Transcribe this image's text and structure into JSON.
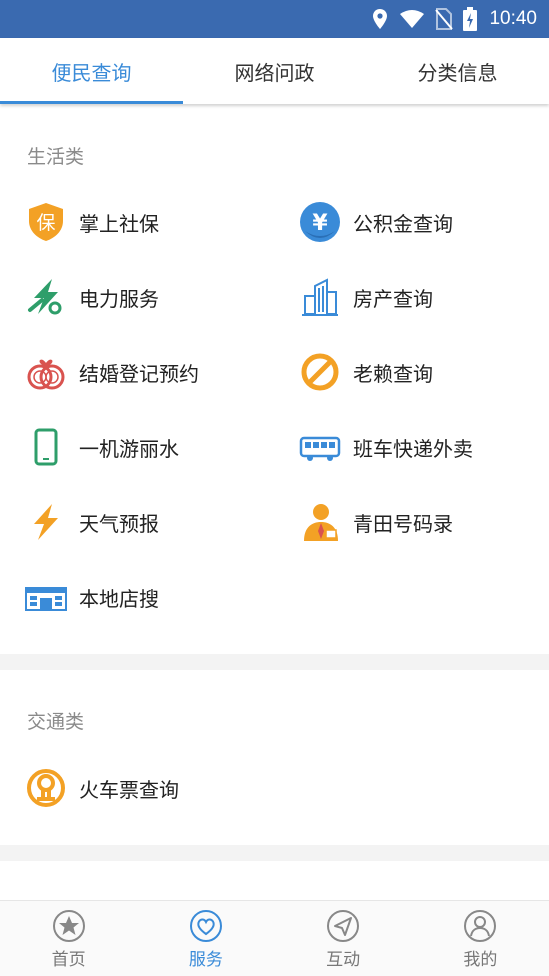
{
  "status_bar": {
    "time": "10:40"
  },
  "tabs": [
    {
      "label": "便民查询",
      "active": true
    },
    {
      "label": "网络问政",
      "active": false
    },
    {
      "label": "分类信息",
      "active": false
    }
  ],
  "sections": {
    "life": {
      "title": "生活类",
      "items": [
        {
          "label": "掌上社保",
          "icon": "social-security-shield-icon"
        },
        {
          "label": "公积金查询",
          "icon": "yen-coin-icon"
        },
        {
          "label": "电力服务",
          "icon": "lightning-wrench-icon"
        },
        {
          "label": "房产查询",
          "icon": "buildings-icon"
        },
        {
          "label": "结婚登记预约",
          "icon": "wedding-rings-icon"
        },
        {
          "label": "老赖查询",
          "icon": "prohibited-icon"
        },
        {
          "label": "一机游丽水",
          "icon": "mobile-phone-icon"
        },
        {
          "label": "班车快递外卖",
          "icon": "bus-icon"
        },
        {
          "label": "天气预报",
          "icon": "lightning-bolt-icon"
        },
        {
          "label": "青田号码录",
          "icon": "person-tie-icon"
        },
        {
          "label": "本地店搜",
          "icon": "storefront-icon"
        }
      ]
    },
    "traffic": {
      "title": "交通类",
      "items": [
        {
          "label": "火车票查询",
          "icon": "railway-logo-icon"
        }
      ]
    }
  },
  "shield_glyph": "保",
  "yen_glyph": "¥",
  "bottom_nav": [
    {
      "label": "首页",
      "icon": "star-circle-icon",
      "active": false
    },
    {
      "label": "服务",
      "icon": "heart-circle-icon",
      "active": true
    },
    {
      "label": "互动",
      "icon": "paper-plane-circle-icon",
      "active": false
    },
    {
      "label": "我的",
      "icon": "user-circle-icon",
      "active": false
    }
  ],
  "colors": {
    "status_bar": "#3a6ab0",
    "accent": "#3a8bd8",
    "orange": "#f3a125",
    "red": "#d9534f",
    "green": "#2e9e6a"
  }
}
